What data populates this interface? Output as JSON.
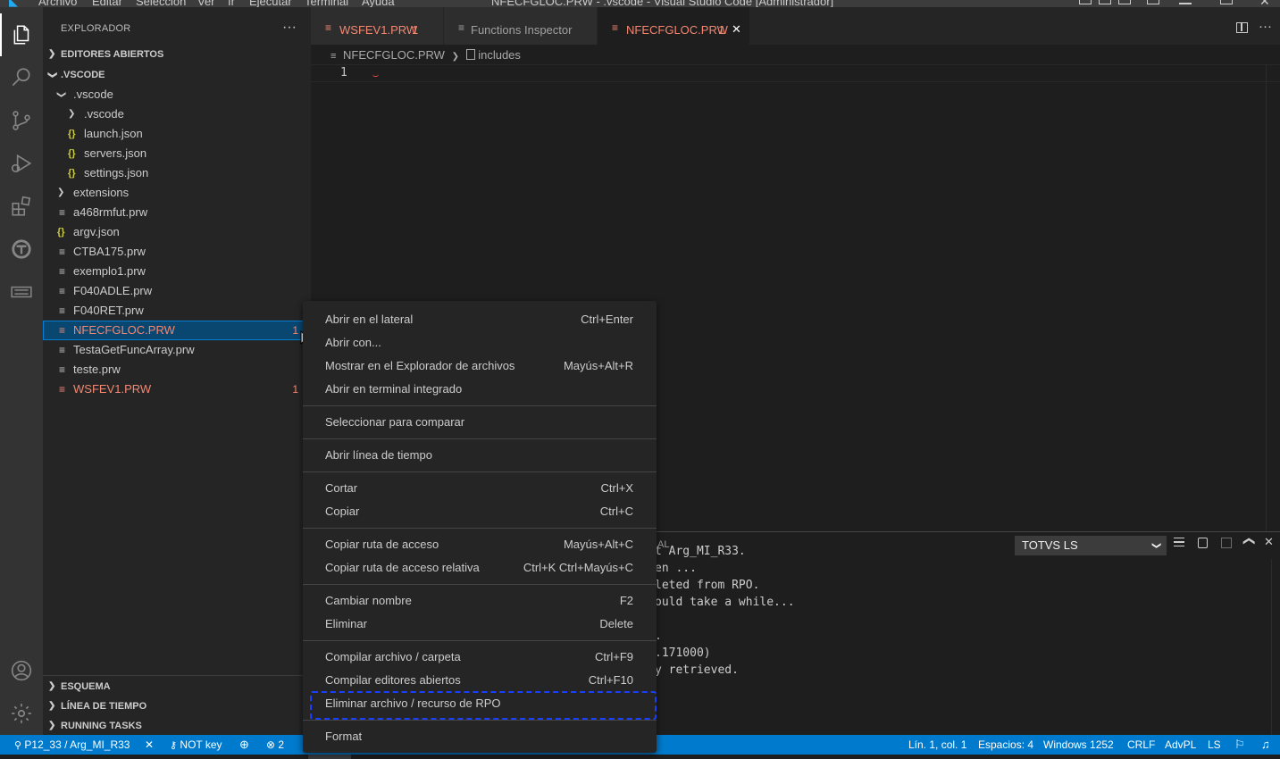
{
  "titlebar": {
    "menus": [
      "Archivo",
      "Editar",
      "Selección",
      "Ver",
      "Ir",
      "Ejecutar",
      "Terminal",
      "Ayuda"
    ],
    "window_title": "NFECFGLOC.PRW - .vscode - Visual Studio Code [Administrador]"
  },
  "activity_bar": {
    "items": [
      "explorer-icon",
      "search-icon",
      "source-control-icon",
      "run-debug-icon",
      "extensions-icon",
      "totvs-icon",
      "remote-icon",
      "account-icon",
      "settings-gear-icon"
    ]
  },
  "sidebar": {
    "title": "EXPLORADOR",
    "more": "···",
    "open_editors": "EDITORES ABIERTOS",
    "root": ".VSCODE",
    "tree": [
      {
        "name": ".vscode",
        "kind": "folder-open",
        "level": 1
      },
      {
        "name": ".vscode",
        "kind": "folder",
        "level": 2
      },
      {
        "name": "launch.json",
        "kind": "json",
        "level": 2
      },
      {
        "name": "servers.json",
        "kind": "json",
        "level": 2
      },
      {
        "name": "settings.json",
        "kind": "json",
        "level": 2
      },
      {
        "name": "extensions",
        "kind": "folder",
        "level": 1
      },
      {
        "name": "a468rmfut.prw",
        "kind": "file",
        "level": 1
      },
      {
        "name": "argv.json",
        "kind": "json",
        "level": 1
      },
      {
        "name": "CTBA175.prw",
        "kind": "file",
        "level": 1
      },
      {
        "name": "exemplo1.prw",
        "kind": "file",
        "level": 1
      },
      {
        "name": "F040ADLE.prw",
        "kind": "file",
        "level": 1
      },
      {
        "name": "F040RET.prw",
        "kind": "file",
        "level": 1
      },
      {
        "name": "NFECFGLOC.PRW",
        "kind": "file",
        "level": 1,
        "error": true,
        "badge": "1",
        "selected": true
      },
      {
        "name": "TestaGetFuncArray.prw",
        "kind": "file",
        "level": 1
      },
      {
        "name": "teste.prw",
        "kind": "file",
        "level": 1
      },
      {
        "name": "WSFEV1.PRW",
        "kind": "file",
        "level": 1,
        "error": true,
        "badge": "1"
      }
    ],
    "bottom_sections": [
      "ESQUEMA",
      "LÍNEA DE TIEMPO",
      "RUNNING TASKS"
    ]
  },
  "tabs": [
    {
      "label": "WSFEV1.PRW",
      "badge": "1",
      "error": true
    },
    {
      "label": "Functions Inspector"
    },
    {
      "label": "NFECFGLOC.PRW",
      "badge": "1",
      "error": true,
      "active": true,
      "close": "✕"
    }
  ],
  "breadcrumb": {
    "file": "NFECFGLOC.PRW",
    "symbol": "includes"
  },
  "editor": {
    "line_number": "1"
  },
  "panel": {
    "tab_fragment": "IAL",
    "dropdown_value": "TOTVS LS",
    "lines": [
      "t Arg_MI_R33.",
      "en ...",
      "leted from RPO.",
      "ould take a while...",
      "",
      ".",
      ".171000)",
      "y retrieved."
    ]
  },
  "context_menu": {
    "groups": [
      [
        {
          "label": "Abrir en el lateral",
          "key": "Ctrl+Enter"
        },
        {
          "label": "Abrir con...",
          "key": ""
        },
        {
          "label": "Mostrar en el Explorador de archivos",
          "key": "Mayús+Alt+R"
        },
        {
          "label": "Abrir en terminal integrado",
          "key": ""
        }
      ],
      [
        {
          "label": "Seleccionar para comparar",
          "key": ""
        }
      ],
      [
        {
          "label": "Abrir línea de tiempo",
          "key": ""
        }
      ],
      [
        {
          "label": "Cortar",
          "key": "Ctrl+X"
        },
        {
          "label": "Copiar",
          "key": "Ctrl+C"
        }
      ],
      [
        {
          "label": "Copiar ruta de acceso",
          "key": "Mayús+Alt+C"
        },
        {
          "label": "Copiar ruta de acceso relativa",
          "key": "Ctrl+K Ctrl+Mayús+C"
        }
      ],
      [
        {
          "label": "Cambiar nombre",
          "key": "F2"
        },
        {
          "label": "Eliminar",
          "key": "Delete"
        }
      ],
      [
        {
          "label": "Compilar archivo / carpeta",
          "key": "Ctrl+F9"
        },
        {
          "label": "Compilar editores abiertos",
          "key": "Ctrl+F10"
        },
        {
          "label": "Eliminar archivo / recurso de RPO",
          "key": "",
          "highlighted": true
        }
      ],
      [
        {
          "label": "Format",
          "key": ""
        }
      ]
    ]
  },
  "statusbar": {
    "server": "P12_33 / Arg_MI_R33",
    "close": "✕",
    "key": "NOT key",
    "errors": "2",
    "position": "Lín. 1, col. 1",
    "spaces": "Espacios: 4",
    "encoding": "Windows 1252",
    "eol": "CRLF",
    "language": "AdvPL",
    "ls": "LS"
  },
  "colors": {
    "accent": "#007acc",
    "error": "#f48771",
    "highlight": "#1a3fff"
  }
}
